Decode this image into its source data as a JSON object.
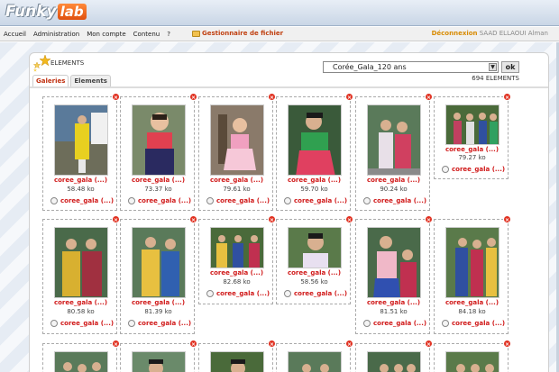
{
  "brand": {
    "part1": "Funky",
    "part2": "lab"
  },
  "menu": [
    "Accueil",
    "Administration",
    "Mon compte",
    "Contenu",
    "?"
  ],
  "file_manager": "Gestionnaire de fichier",
  "user": {
    "logout": "Déconnexion",
    "name": "SAAD ELLAOUI Alman"
  },
  "section_label": "ELEMENTS",
  "tabs": [
    "Galeries",
    "Elements"
  ],
  "gallery_select": {
    "value": "Corée_Gala_120 ans",
    "ok": "ok"
  },
  "element_count": "694 ELEMENTS",
  "items": [
    {
      "caption": "coree_gala (...)",
      "size": "58.48 ko",
      "radio_label": "coree_gala (...)"
    },
    {
      "caption": "coree_gala (...)",
      "size": "73.37 ko",
      "radio_label": "coree_gala (...)"
    },
    {
      "caption": "coree_gala (...)",
      "size": "79.61 ko",
      "radio_label": "coree_gala (...)"
    },
    {
      "caption": "coree_gala (...)",
      "size": "59.70 ko",
      "radio_label": "coree_gala (...)"
    },
    {
      "caption": "coree_gala (...)",
      "size": "90.24 ko",
      "radio_label": "coree_gala (...)"
    },
    {
      "caption": "coree_gala (...)",
      "size": "79.27 ko",
      "radio_label": "coree_gala (...)"
    },
    {
      "caption": "coree_gala (...)",
      "size": "80.58 ko",
      "radio_label": "coree_gala (...)"
    },
    {
      "caption": "coree_gala (...)",
      "size": "81.39 ko",
      "radio_label": "coree_gala (...)"
    },
    {
      "caption": "coree_gala (...)",
      "size": "82.68 ko",
      "radio_label": "coree_gala (...)"
    },
    {
      "caption": "coree_gala (...)",
      "size": "58.56 ko",
      "radio_label": "coree_gala (...)"
    },
    {
      "caption": "coree_gala (...)",
      "size": "81.51 ko",
      "radio_label": "coree_gala (...)"
    },
    {
      "caption": "coree_gala (...)",
      "size": "84.18 ko",
      "radio_label": "coree_gala (...)"
    }
  ],
  "colors": {
    "accent": "#d01818",
    "brand_orange": "#e0500f",
    "logout": "#d88a00"
  }
}
